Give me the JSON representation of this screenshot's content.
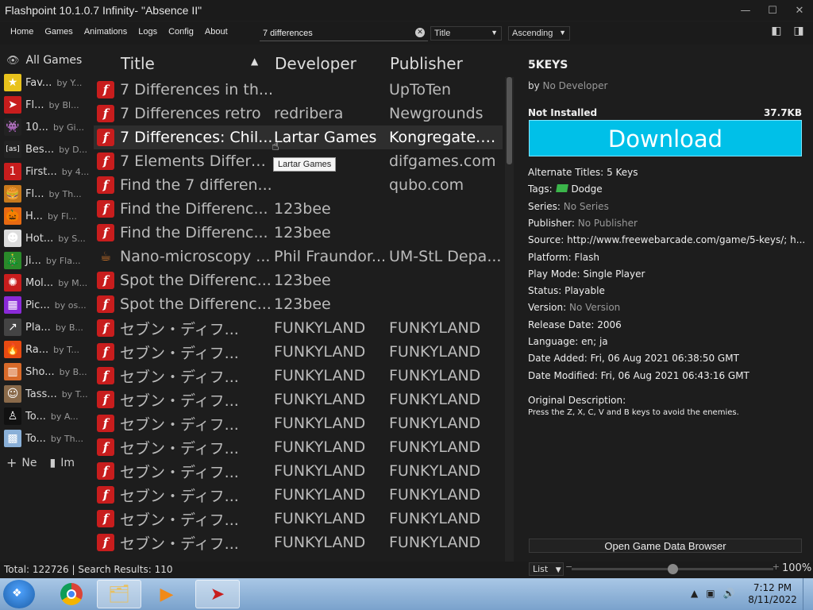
{
  "window": {
    "title": "Flashpoint 10.1.0.7 Infinity- \"Absence II\"",
    "minimize": "—",
    "maximize": "☐",
    "close": "✕"
  },
  "menu": [
    "Home",
    "Games",
    "Animations",
    "Logs",
    "Config",
    "About"
  ],
  "search": {
    "value": "7 differences"
  },
  "order_by": "Title",
  "order_direction": "Ascending",
  "sidebar": {
    "all_label": "All Games",
    "playlists": [
      {
        "name": "Fav...",
        "by": "by Y...",
        "icon": "star-icon",
        "color": "#e8c21c"
      },
      {
        "name": "Fl...",
        "by": "by Bl...",
        "icon": "flash-arrow-icon",
        "color": "#c81d1d"
      },
      {
        "name": "10...",
        "by": "by Gi...",
        "icon": "space-invader-icon",
        "color": "#222222"
      },
      {
        "name": "Bes...",
        "by": "by D...",
        "icon": "as-logo-icon",
        "color": "#222222"
      },
      {
        "name": "First...",
        "by": "by 4...",
        "icon": "number-one-icon",
        "color": "#c81d1d"
      },
      {
        "name": "Fl...",
        "by": "by Th...",
        "icon": "burger-icon",
        "color": "#c87a1d"
      },
      {
        "name": "H...",
        "by": "by Fl...",
        "icon": "pumpkin-icon",
        "color": "#e86a12"
      },
      {
        "name": "Hot...",
        "by": "by S...",
        "icon": "face-icon",
        "color": "#dddddd"
      },
      {
        "name": "Ji...",
        "by": "by Fla...",
        "icon": "tree-icon",
        "color": "#2a8a2a"
      },
      {
        "name": "Mol...",
        "by": "by M...",
        "icon": "molecule-icon",
        "color": "#c81d1d"
      },
      {
        "name": "Pic...",
        "by": "by os...",
        "icon": "pixel-icon",
        "color": "#8a2ad8"
      },
      {
        "name": "Pla...",
        "by": "by B...",
        "icon": "share-icon",
        "color": "#444444"
      },
      {
        "name": "Ra...",
        "by": "by T...",
        "icon": "fire-icon",
        "color": "#e84a12"
      },
      {
        "name": "Sho...",
        "by": "by B...",
        "icon": "audio-wave-icon",
        "color": "#d86a2a"
      },
      {
        "name": "Tass...",
        "by": "by T...",
        "icon": "portrait-icon",
        "color": "#8a6a4a"
      },
      {
        "name": "To...",
        "by": "by A...",
        "icon": "silhouette-icon",
        "color": "#111111"
      },
      {
        "name": "To...",
        "by": "by Th...",
        "icon": "blocks-icon",
        "color": "#8ab0d8"
      }
    ],
    "new_label": "Ne",
    "import_label": "Im"
  },
  "table": {
    "headers": {
      "title": "Title",
      "developer": "Developer",
      "publisher": "Publisher"
    },
    "rows": [
      {
        "title": "7 Differences in th...",
        "developer": "",
        "publisher": "UpToTen",
        "platform": "flash"
      },
      {
        "title": "7 Differences retro",
        "developer": "redribera",
        "publisher": "Newgrounds",
        "platform": "flash"
      },
      {
        "title": "7 Differences: Chil...",
        "developer": "Lartar Games",
        "publisher": "Kongregate.c...",
        "platform": "flash",
        "selected": true
      },
      {
        "title": "7 Elements Differe...",
        "developer": "",
        "publisher": "difgames.com",
        "platform": "flash"
      },
      {
        "title": "Find the 7 differen...",
        "developer": "",
        "publisher": "qubo.com",
        "platform": "flash"
      },
      {
        "title": "Find the Differenc...",
        "developer": "123bee",
        "publisher": "",
        "platform": "flash"
      },
      {
        "title": "Find the Differenc...",
        "developer": "123bee",
        "publisher": "",
        "platform": "flash"
      },
      {
        "title": "Nano-microscopy ...",
        "developer": "Phil Fraundor...",
        "publisher": "UM-StL Depa...",
        "platform": "java"
      },
      {
        "title": "Spot the Differenc...",
        "developer": "123bee",
        "publisher": "",
        "platform": "flash"
      },
      {
        "title": "Spot the Differenc...",
        "developer": "123bee",
        "publisher": "",
        "platform": "flash"
      },
      {
        "title": "セブン・ディフ...",
        "developer": "FUNKYLAND",
        "publisher": "FUNKYLAND",
        "platform": "flash"
      },
      {
        "title": "セブン・ディフ...",
        "developer": "FUNKYLAND",
        "publisher": "FUNKYLAND",
        "platform": "flash"
      },
      {
        "title": "セブン・ディフ...",
        "developer": "FUNKYLAND",
        "publisher": "FUNKYLAND",
        "platform": "flash"
      },
      {
        "title": "セブン・ディフ...",
        "developer": "FUNKYLAND",
        "publisher": "FUNKYLAND",
        "platform": "flash"
      },
      {
        "title": "セブン・ディフ...",
        "developer": "FUNKYLAND",
        "publisher": "FUNKYLAND",
        "platform": "flash"
      },
      {
        "title": "セブン・ディフ...",
        "developer": "FUNKYLAND",
        "publisher": "FUNKYLAND",
        "platform": "flash"
      },
      {
        "title": "セブン・ディフ...",
        "developer": "FUNKYLAND",
        "publisher": "FUNKYLAND",
        "platform": "flash"
      },
      {
        "title": "セブン・ディフ...",
        "developer": "FUNKYLAND",
        "publisher": "FUNKYLAND",
        "platform": "flash"
      },
      {
        "title": "セブン・ディフ...",
        "developer": "FUNKYLAND",
        "publisher": "FUNKYLAND",
        "platform": "flash"
      },
      {
        "title": "セブン・ディフ...",
        "developer": "FUNKYLAND",
        "publisher": "FUNKYLAND",
        "platform": "flash"
      }
    ],
    "tooltip": "Lartar Games"
  },
  "details": {
    "title": "5KEYS",
    "by_prefix": "by",
    "developer": "No Developer",
    "install_status": "Not Installed",
    "size": "37.7KB",
    "download_label": "Download",
    "fields": [
      {
        "label": "Alternate Titles:",
        "value": "5 Keys",
        "muted": false
      },
      {
        "label": "Tags:",
        "value": "Dodge",
        "muted": false,
        "tag": true
      },
      {
        "label": "Series:",
        "value": "No Series",
        "muted": true
      },
      {
        "label": "Publisher:",
        "value": "No Publisher",
        "muted": true
      },
      {
        "label": "Source:",
        "value": "http://www.freewebarcade.com/game/5-keys/; h...",
        "muted": false
      },
      {
        "label": "Platform:",
        "value": "Flash",
        "muted": false
      },
      {
        "label": "Play Mode:",
        "value": "Single Player",
        "muted": false
      },
      {
        "label": "Status:",
        "value": "Playable",
        "muted": false
      },
      {
        "label": "Version:",
        "value": "No Version",
        "muted": true
      },
      {
        "label": "Release Date:",
        "value": "2006",
        "muted": false
      },
      {
        "label": "Language:",
        "value": "en; ja",
        "muted": false
      },
      {
        "label": "Date Added:",
        "value": " Fri, 06 Aug 2021 06:38:50 GMT",
        "muted": false
      },
      {
        "label": "Date Modified:",
        "value": " Fri, 06 Aug 2021 06:43:16 GMT",
        "muted": false
      }
    ],
    "description_label": "Original Description:",
    "description": "Press the Z, X, C, V and B keys to avoid the enemies.",
    "browser_button": "Open Game Data Browser"
  },
  "statusbar": {
    "text": "Total: 122726  |  Search Results: 110",
    "view_mode": "List",
    "zoom": "100%",
    "zoom_fraction": 0.5
  },
  "taskbar": {
    "time": "7:12 PM",
    "date": "8/11/2022"
  },
  "colors": {
    "accent": "#00c0e8",
    "flash_red": "#c81d1d"
  }
}
